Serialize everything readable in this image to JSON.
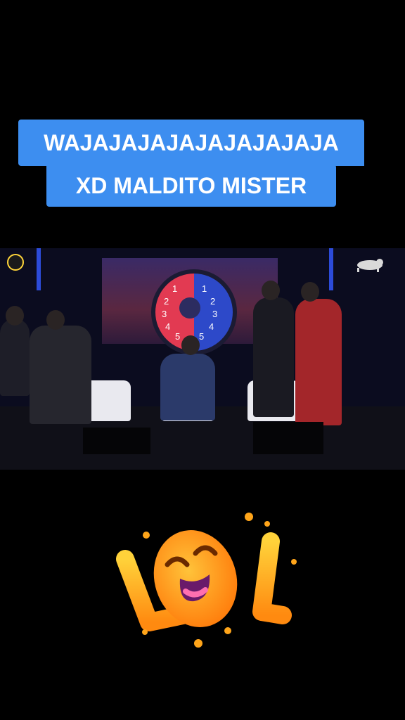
{
  "caption": {
    "line1": "WAJAJAJAJAJAJAJAJAJA",
    "line2": "XD MALDITO MISTER"
  },
  "video": {
    "wheel_numbers_left": [
      "5",
      "4",
      "3",
      "2",
      "1"
    ],
    "wheel_numbers_right": [
      "1",
      "2",
      "3",
      "4",
      "5"
    ]
  },
  "sticker": {
    "icon": "lol-laughing-sticker-icon"
  },
  "colors": {
    "caption_bg": "#3d8ef0",
    "sticker_orange": "#ff9a1f",
    "background": "#000000"
  }
}
